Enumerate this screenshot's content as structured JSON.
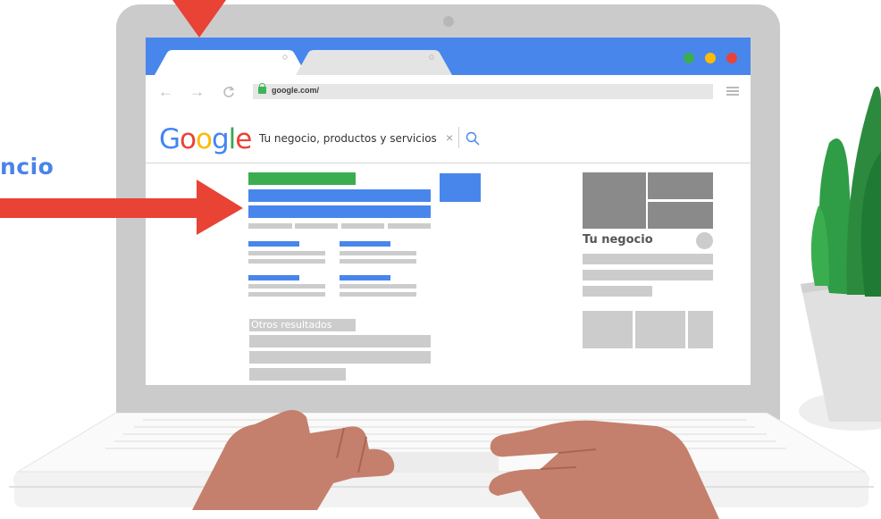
{
  "side_label": "ncio",
  "browser": {
    "url": "google.com/",
    "window_dot_colors": [
      "#3aae4e",
      "#fbbc05",
      "#ea4335"
    ]
  },
  "search": {
    "logo_letters": [
      {
        "ch": "G",
        "color": "#4285f4"
      },
      {
        "ch": "o",
        "color": "#ea4335"
      },
      {
        "ch": "o",
        "color": "#fbbc05"
      },
      {
        "ch": "g",
        "color": "#4285f4"
      },
      {
        "ch": "l",
        "color": "#34a853"
      },
      {
        "ch": "e",
        "color": "#ea4335"
      }
    ],
    "query": "Tu negocio, productos y servicios",
    "clear_symbol": "×"
  },
  "results": {
    "other_results_label": "Otros resultados"
  },
  "business_panel": {
    "name": "Tu negocio"
  },
  "colors": {
    "accent_blue": "#4886ec",
    "arrow_red": "#e84335",
    "ad_green": "#3aae4e",
    "skin": "#c4806c",
    "laptop_grey": "#cbcbcb"
  }
}
